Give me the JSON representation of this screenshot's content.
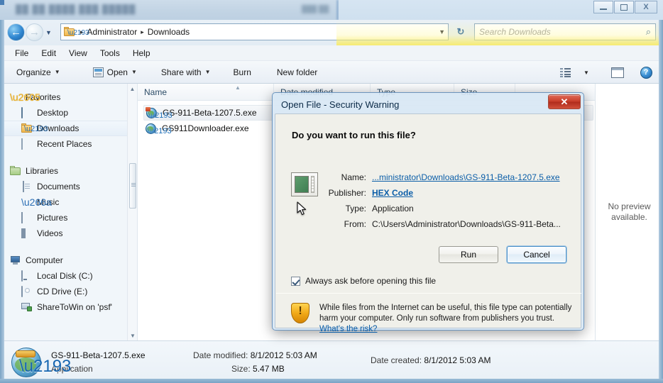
{
  "window": {
    "background_title_blurred": "██  ██  ████  ███  █████",
    "background_right_blurred": "███ ██",
    "controls": {
      "minimize": "minimize",
      "maximize": "maximize",
      "close": "X"
    }
  },
  "navigation": {
    "back_arrow": "←",
    "forward_arrow": "→",
    "history_caret": "▼",
    "breadcrumb": {
      "folder_arrow": "▸",
      "separator": "▸",
      "items": [
        "Administrator",
        "Downloads"
      ]
    },
    "address_dropdown_caret": "▼",
    "refresh_glyph": "↻"
  },
  "search": {
    "placeholder": "Search Downloads",
    "icon": "⌕"
  },
  "menubar": {
    "items": [
      "File",
      "Edit",
      "View",
      "Tools",
      "Help"
    ]
  },
  "toolbar": {
    "organize": "Organize",
    "open": "Open",
    "share_with": "Share with",
    "burn": "Burn",
    "new_folder": "New folder",
    "caret": "▼",
    "help_glyph": "?"
  },
  "sidebar": {
    "groups": [
      {
        "header": "Favorites",
        "items": [
          "Desktop",
          "Downloads",
          "Recent Places"
        ]
      },
      {
        "header": "Libraries",
        "items": [
          "Documents",
          "Music",
          "Pictures",
          "Videos"
        ]
      },
      {
        "header": "Computer",
        "items": [
          "Local Disk (C:)",
          "CD Drive (E:)",
          "ShareToWin on 'psf'"
        ]
      }
    ],
    "selected": "Downloads",
    "scroll_up": "▲",
    "scroll_down": "▼"
  },
  "filelist": {
    "columns": [
      "Name",
      "Date modified",
      "Type",
      "Size"
    ],
    "sort_mark": "▲",
    "rows": [
      {
        "name": "GS-911-Beta-1207.5.exe",
        "selected": true
      },
      {
        "name": "GS911Downloader.exe",
        "selected": false
      }
    ]
  },
  "preview": {
    "line1": "No preview",
    "line2": "available."
  },
  "details": {
    "filename": "GS-911-Beta-1207.5.exe",
    "filetype": "Application",
    "date_modified_label": "Date modified:",
    "date_modified_value": "8/1/2012 5:03 AM",
    "size_label": "Size:",
    "size_value": "5.47 MB",
    "date_created_label": "Date created:",
    "date_created_value": "8/1/2012 5:03 AM"
  },
  "dialog": {
    "title": "Open File - Security Warning",
    "close_glyph": "✕",
    "question": "Do you want to run this file?",
    "fields": [
      {
        "label": "Name:",
        "value": "...ministrator\\Downloads\\GS-911-Beta-1207.5.exe",
        "link": true,
        "bold": false
      },
      {
        "label": "Publisher:",
        "value": "HEX Code",
        "link": true,
        "bold": true
      },
      {
        "label": "Type:",
        "value": "Application",
        "link": false,
        "bold": false
      },
      {
        "label": "From:",
        "value": "C:\\Users\\Administrator\\Downloads\\GS-911-Beta...",
        "link": false,
        "bold": false
      }
    ],
    "buttons": {
      "run": "Run",
      "cancel": "Cancel"
    },
    "checkbox": {
      "label": "Always ask before opening this file",
      "checked": true
    },
    "warning": {
      "icon": "warning-shield",
      "bang": "!",
      "text": "While files from the Internet can be useful, this file type can potentially harm your computer. Only run software from publishers you trust. ",
      "link": "What's the risk?"
    }
  },
  "colors": {
    "accent_blue": "#2f86d0",
    "dialog_close_red": "#c83d28",
    "warning_amber": "#f0a818",
    "link_blue": "#0b5ea8",
    "highlight_yellow": "#faeb5a"
  }
}
